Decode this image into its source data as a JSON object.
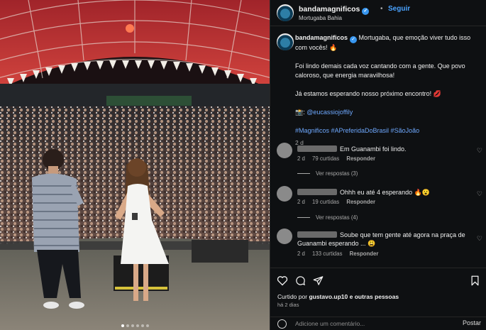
{
  "account": {
    "username": "bandamagnificos",
    "follow_label": "Seguir",
    "separator": "•",
    "location": "Mortugaba Bahia"
  },
  "caption": {
    "line1": "Mortugaba, que emoção viver tudo isso com vocês! 🔥",
    "line2": "Foi lindo demais cada voz cantando com a gente. Que povo caloroso, que energia maravilhosa!",
    "line3": "Já estamos esperando nosso próximo encontro! 💋",
    "credit_prefix": "📸:",
    "credit_handle": "@eucassiojoffily",
    "hashtags": "#Magnificos #APreferidaDoBrasil #SãoJoão",
    "time": "2 d"
  },
  "comments": [
    {
      "text": "Em Guanambi foi lindo.",
      "time": "2 d",
      "likes": "79 curtidas",
      "reply": "Responder",
      "view_replies": "Ver respostas (3)"
    },
    {
      "text": "Ohhh eu até 4 esperando 🔥😮",
      "time": "2 d",
      "likes": "19 curtidas",
      "reply": "Responder",
      "view_replies": "Ver respostas (4)"
    },
    {
      "text": "Soube que tem gente até agora na praça de Guanambi esperando ... 😩",
      "time": "2 d",
      "likes": "133 curtidas",
      "reply": "Responder"
    }
  ],
  "footer": {
    "liked_by_prefix": "Curtido por",
    "liked_by_user": "gustavo.up10",
    "liked_by_suffix": "e outras pessoas",
    "posted": "há 2 dias",
    "comment_placeholder": "Adicione um comentário...",
    "post_label": "Postar"
  },
  "icons": [
    "verified-badge-icon",
    "heart-icon",
    "comment-icon",
    "share-icon",
    "save-icon",
    "emoji-icon"
  ],
  "colors": {
    "accent": "#4aa3ff",
    "verified": "#3897f0",
    "background": "#0e1012"
  },
  "carousel": {
    "total": 6,
    "active": 1
  }
}
